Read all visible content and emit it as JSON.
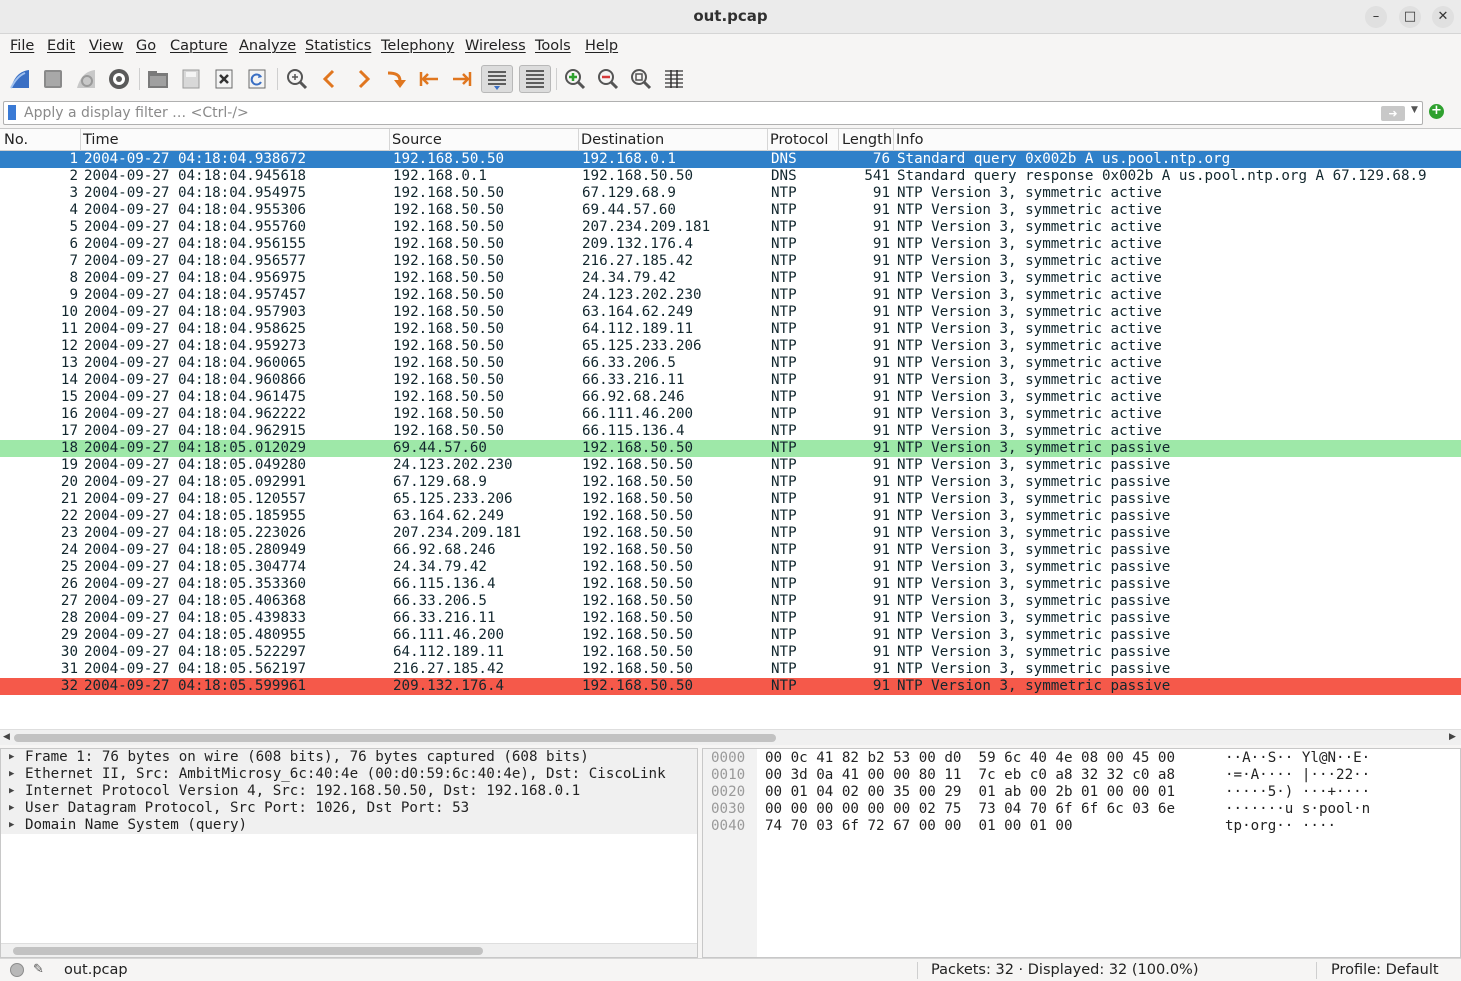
{
  "window": {
    "title": "out.pcap"
  },
  "menu": [
    "File",
    "Edit",
    "View",
    "Go",
    "Capture",
    "Analyze",
    "Statistics",
    "Telephony",
    "Wireless",
    "Tools",
    "Help"
  ],
  "toolbar": {
    "icons": [
      "start-capture-icon",
      "stop-capture-icon",
      "restart-capture-icon",
      "capture-options-icon",
      "open-file-icon",
      "save-file-icon",
      "close-file-icon",
      "reload-file-icon",
      "find-packet-icon",
      "go-back-icon",
      "go-forward-icon",
      "go-to-packet-icon",
      "go-first-icon",
      "go-last-icon",
      "auto-scroll-icon",
      "colorize-icon",
      "zoom-in-icon",
      "zoom-out-icon",
      "normal-size-icon",
      "resize-columns-icon"
    ]
  },
  "filter": {
    "placeholder": "Apply a display filter … <Ctrl-/>",
    "value": ""
  },
  "columns": {
    "no": "No.",
    "time": "Time",
    "source": "Source",
    "destination": "Destination",
    "protocol": "Protocol",
    "length": "Length",
    "info": "Info"
  },
  "packets": [
    {
      "no": "1",
      "time": "2004-09-27 04:18:04.938672",
      "src": "192.168.50.50",
      "dst": "192.168.0.1",
      "proto": "DNS",
      "len": "76",
      "info": "Standard query 0x002b A us.pool.ntp.org",
      "style": "selected"
    },
    {
      "no": "2",
      "time": "2004-09-27 04:18:04.945618",
      "src": "192.168.0.1",
      "dst": "192.168.50.50",
      "proto": "DNS",
      "len": "541",
      "info": "Standard query response 0x002b A us.pool.ntp.org A 67.129.68.9",
      "style": ""
    },
    {
      "no": "3",
      "time": "2004-09-27 04:18:04.954975",
      "src": "192.168.50.50",
      "dst": "67.129.68.9",
      "proto": "NTP",
      "len": "91",
      "info": "NTP Version 3, symmetric active",
      "style": ""
    },
    {
      "no": "4",
      "time": "2004-09-27 04:18:04.955306",
      "src": "192.168.50.50",
      "dst": "69.44.57.60",
      "proto": "NTP",
      "len": "91",
      "info": "NTP Version 3, symmetric active",
      "style": ""
    },
    {
      "no": "5",
      "time": "2004-09-27 04:18:04.955760",
      "src": "192.168.50.50",
      "dst": "207.234.209.181",
      "proto": "NTP",
      "len": "91",
      "info": "NTP Version 3, symmetric active",
      "style": ""
    },
    {
      "no": "6",
      "time": "2004-09-27 04:18:04.956155",
      "src": "192.168.50.50",
      "dst": "209.132.176.4",
      "proto": "NTP",
      "len": "91",
      "info": "NTP Version 3, symmetric active",
      "style": ""
    },
    {
      "no": "7",
      "time": "2004-09-27 04:18:04.956577",
      "src": "192.168.50.50",
      "dst": "216.27.185.42",
      "proto": "NTP",
      "len": "91",
      "info": "NTP Version 3, symmetric active",
      "style": ""
    },
    {
      "no": "8",
      "time": "2004-09-27 04:18:04.956975",
      "src": "192.168.50.50",
      "dst": "24.34.79.42",
      "proto": "NTP",
      "len": "91",
      "info": "NTP Version 3, symmetric active",
      "style": ""
    },
    {
      "no": "9",
      "time": "2004-09-27 04:18:04.957457",
      "src": "192.168.50.50",
      "dst": "24.123.202.230",
      "proto": "NTP",
      "len": "91",
      "info": "NTP Version 3, symmetric active",
      "style": ""
    },
    {
      "no": "10",
      "time": "2004-09-27 04:18:04.957903",
      "src": "192.168.50.50",
      "dst": "63.164.62.249",
      "proto": "NTP",
      "len": "91",
      "info": "NTP Version 3, symmetric active",
      "style": ""
    },
    {
      "no": "11",
      "time": "2004-09-27 04:18:04.958625",
      "src": "192.168.50.50",
      "dst": "64.112.189.11",
      "proto": "NTP",
      "len": "91",
      "info": "NTP Version 3, symmetric active",
      "style": ""
    },
    {
      "no": "12",
      "time": "2004-09-27 04:18:04.959273",
      "src": "192.168.50.50",
      "dst": "65.125.233.206",
      "proto": "NTP",
      "len": "91",
      "info": "NTP Version 3, symmetric active",
      "style": ""
    },
    {
      "no": "13",
      "time": "2004-09-27 04:18:04.960065",
      "src": "192.168.50.50",
      "dst": "66.33.206.5",
      "proto": "NTP",
      "len": "91",
      "info": "NTP Version 3, symmetric active",
      "style": ""
    },
    {
      "no": "14",
      "time": "2004-09-27 04:18:04.960866",
      "src": "192.168.50.50",
      "dst": "66.33.216.11",
      "proto": "NTP",
      "len": "91",
      "info": "NTP Version 3, symmetric active",
      "style": ""
    },
    {
      "no": "15",
      "time": "2004-09-27 04:18:04.961475",
      "src": "192.168.50.50",
      "dst": "66.92.68.246",
      "proto": "NTP",
      "len": "91",
      "info": "NTP Version 3, symmetric active",
      "style": ""
    },
    {
      "no": "16",
      "time": "2004-09-27 04:18:04.962222",
      "src": "192.168.50.50",
      "dst": "66.111.46.200",
      "proto": "NTP",
      "len": "91",
      "info": "NTP Version 3, symmetric active",
      "style": ""
    },
    {
      "no": "17",
      "time": "2004-09-27 04:18:04.962915",
      "src": "192.168.50.50",
      "dst": "66.115.136.4",
      "proto": "NTP",
      "len": "91",
      "info": "NTP Version 3, symmetric active",
      "style": ""
    },
    {
      "no": "18",
      "time": "2004-09-27 04:18:05.012029",
      "src": "69.44.57.60",
      "dst": "192.168.50.50",
      "proto": "NTP",
      "len": "91",
      "info": "NTP Version 3, symmetric passive",
      "style": "green"
    },
    {
      "no": "19",
      "time": "2004-09-27 04:18:05.049280",
      "src": "24.123.202.230",
      "dst": "192.168.50.50",
      "proto": "NTP",
      "len": "91",
      "info": "NTP Version 3, symmetric passive",
      "style": ""
    },
    {
      "no": "20",
      "time": "2004-09-27 04:18:05.092991",
      "src": "67.129.68.9",
      "dst": "192.168.50.50",
      "proto": "NTP",
      "len": "91",
      "info": "NTP Version 3, symmetric passive",
      "style": ""
    },
    {
      "no": "21",
      "time": "2004-09-27 04:18:05.120557",
      "src": "65.125.233.206",
      "dst": "192.168.50.50",
      "proto": "NTP",
      "len": "91",
      "info": "NTP Version 3, symmetric passive",
      "style": ""
    },
    {
      "no": "22",
      "time": "2004-09-27 04:18:05.185955",
      "src": "63.164.62.249",
      "dst": "192.168.50.50",
      "proto": "NTP",
      "len": "91",
      "info": "NTP Version 3, symmetric passive",
      "style": ""
    },
    {
      "no": "23",
      "time": "2004-09-27 04:18:05.223026",
      "src": "207.234.209.181",
      "dst": "192.168.50.50",
      "proto": "NTP",
      "len": "91",
      "info": "NTP Version 3, symmetric passive",
      "style": ""
    },
    {
      "no": "24",
      "time": "2004-09-27 04:18:05.280949",
      "src": "66.92.68.246",
      "dst": "192.168.50.50",
      "proto": "NTP",
      "len": "91",
      "info": "NTP Version 3, symmetric passive",
      "style": ""
    },
    {
      "no": "25",
      "time": "2004-09-27 04:18:05.304774",
      "src": "24.34.79.42",
      "dst": "192.168.50.50",
      "proto": "NTP",
      "len": "91",
      "info": "NTP Version 3, symmetric passive",
      "style": ""
    },
    {
      "no": "26",
      "time": "2004-09-27 04:18:05.353360",
      "src": "66.115.136.4",
      "dst": "192.168.50.50",
      "proto": "NTP",
      "len": "91",
      "info": "NTP Version 3, symmetric passive",
      "style": ""
    },
    {
      "no": "27",
      "time": "2004-09-27 04:18:05.406368",
      "src": "66.33.206.5",
      "dst": "192.168.50.50",
      "proto": "NTP",
      "len": "91",
      "info": "NTP Version 3, symmetric passive",
      "style": ""
    },
    {
      "no": "28",
      "time": "2004-09-27 04:18:05.439833",
      "src": "66.33.216.11",
      "dst": "192.168.50.50",
      "proto": "NTP",
      "len": "91",
      "info": "NTP Version 3, symmetric passive",
      "style": ""
    },
    {
      "no": "29",
      "time": "2004-09-27 04:18:05.480955",
      "src": "66.111.46.200",
      "dst": "192.168.50.50",
      "proto": "NTP",
      "len": "91",
      "info": "NTP Version 3, symmetric passive",
      "style": ""
    },
    {
      "no": "30",
      "time": "2004-09-27 04:18:05.522297",
      "src": "64.112.189.11",
      "dst": "192.168.50.50",
      "proto": "NTP",
      "len": "91",
      "info": "NTP Version 3, symmetric passive",
      "style": ""
    },
    {
      "no": "31",
      "time": "2004-09-27 04:18:05.562197",
      "src": "216.27.185.42",
      "dst": "192.168.50.50",
      "proto": "NTP",
      "len": "91",
      "info": "NTP Version 3, symmetric passive",
      "style": ""
    },
    {
      "no": "32",
      "time": "2004-09-27 04:18:05.599961",
      "src": "209.132.176.4",
      "dst": "192.168.50.50",
      "proto": "NTP",
      "len": "91",
      "info": "NTP Version 3, symmetric passive",
      "style": "red"
    }
  ],
  "row_colors": {
    "selected": "#2f80c9",
    "green": "#9ee8a8",
    "red": "#f5594a"
  },
  "details": [
    "Frame 1: 76 bytes on wire (608 bits), 76 bytes captured (608 bits)",
    "Ethernet II, Src: AmbitMicrosy_6c:40:4e (00:d0:59:6c:40:4e), Dst: CiscoLink",
    "Internet Protocol Version 4, Src: 192.168.50.50, Dst: 192.168.0.1",
    "User Datagram Protocol, Src Port: 1026, Dst Port: 53",
    "Domain Name System (query)"
  ],
  "bytes": [
    {
      "off": "0000",
      "hex": "00 0c 41 82 b2 53 00 d0  59 6c 40 4e 08 00 45 00",
      "ascii": "··A··S·· Yl@N··E·"
    },
    {
      "off": "0010",
      "hex": "00 3d 0a 41 00 00 80 11  7c eb c0 a8 32 32 c0 a8",
      "ascii": "·=·A···· |···22··"
    },
    {
      "off": "0020",
      "hex": "00 01 04 02 00 35 00 29  01 ab 00 2b 01 00 00 01",
      "ascii": "·····5·) ···+····"
    },
    {
      "off": "0030",
      "hex": "00 00 00 00 00 00 02 75  73 04 70 6f 6f 6c 03 6e",
      "ascii": "·······u s·pool·n"
    },
    {
      "off": "0040",
      "hex": "74 70 03 6f 72 67 00 00  01 00 01 00",
      "ascii": "tp·org·· ····"
    }
  ],
  "status": {
    "file": "out.pcap",
    "packets": "Packets: 32 · Displayed: 32 (100.0%)",
    "profile": "Profile: Default"
  }
}
